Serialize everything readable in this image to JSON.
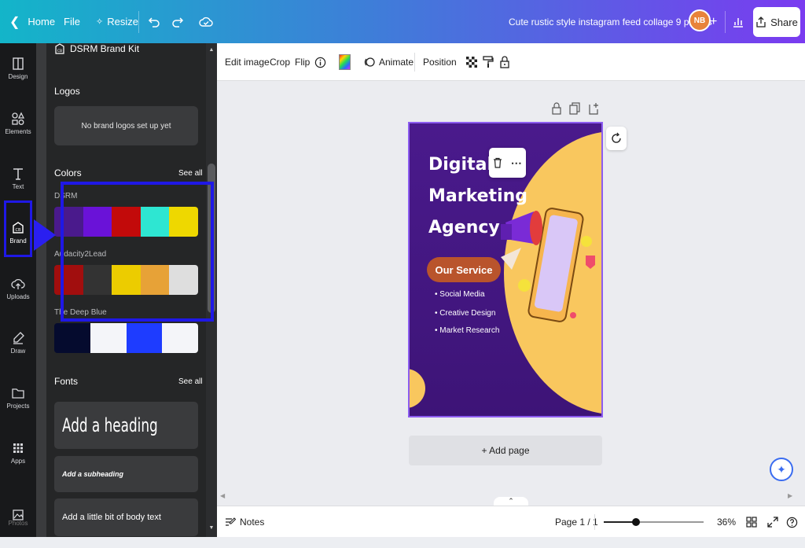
{
  "topbar": {
    "home_label": "Home",
    "file_label": "File",
    "resize_label": "Resize",
    "doc_title": "Cute rustic style instagram feed collage 9 photos",
    "avatar_initials": "NB",
    "share_label": "Share"
  },
  "rail": {
    "items": [
      {
        "label": "Design",
        "icon": "design-icon"
      },
      {
        "label": "Elements",
        "icon": "elements-icon"
      },
      {
        "label": "Text",
        "icon": "text-icon"
      },
      {
        "label": "Brand",
        "icon": "brand-icon"
      },
      {
        "label": "Uploads",
        "icon": "uploads-icon"
      },
      {
        "label": "Draw",
        "icon": "draw-icon"
      },
      {
        "label": "Projects",
        "icon": "projects-icon"
      },
      {
        "label": "Apps",
        "icon": "apps-icon"
      },
      {
        "label": "Photos",
        "icon": "photos-icon"
      }
    ]
  },
  "panel": {
    "kit_name": "DSRM Brand Kit",
    "logos_title": "Logos",
    "logos_empty": "No brand logos set up yet",
    "colors_title": "Colors",
    "colors_see_all": "See all",
    "palettes": [
      {
        "name": "DSRM",
        "colors": [
          "#4a1a8c",
          "#6a12d8",
          "#c20a0a",
          "#2ee6d2",
          "#eed800"
        ]
      },
      {
        "name": "Audacity2Lead",
        "colors": [
          "#a10e0e",
          "#333333",
          "#eccc00",
          "#e7a237",
          "#dedede"
        ]
      },
      {
        "name": "The Deep Blue",
        "colors": [
          "#050b2e",
          "#f4f5f9",
          "#1e3cff",
          "#f4f5f9"
        ]
      }
    ],
    "fonts_title": "Fonts",
    "fonts_see_all": "See all",
    "font_heading": "Add a heading",
    "font_subheading": "Add a subheading",
    "font_body": "Add a little bit of body text"
  },
  "canvas_toolbar": {
    "edit_image": "Edit image",
    "crop": "Crop",
    "flip": "Flip",
    "animate": "Animate",
    "position": "Position"
  },
  "design": {
    "headline_1": "Digital",
    "headline_2": "Marketing",
    "headline_3": "Agency",
    "service_label": "Our Service",
    "bullets": [
      "Social Media",
      "Creative Design",
      "Market Research"
    ],
    "colors": {
      "bg": "#4a1a8c",
      "accent": "#f9c75e",
      "pill": "#b9542c"
    }
  },
  "workspace": {
    "add_page_label": "+ Add page"
  },
  "bottombar": {
    "notes_label": "Notes",
    "page_label": "Page 1 / 1",
    "zoom_value": 36,
    "zoom_label": "36%"
  }
}
